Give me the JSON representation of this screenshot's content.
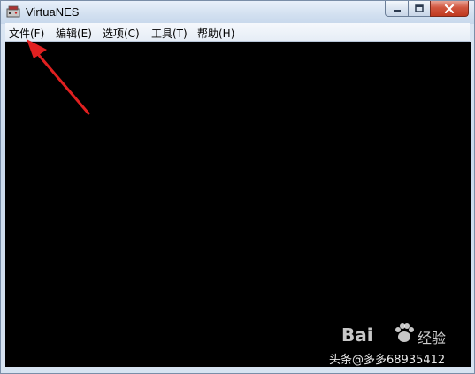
{
  "window": {
    "title": "VirtuaNES",
    "icon": "virtuanes-app-icon"
  },
  "title_buttons": {
    "minimize_icon": "minimize-icon",
    "maximize_icon": "maximize-icon",
    "close_icon": "close-icon"
  },
  "menubar": {
    "items": [
      {
        "label": "文件(F)"
      },
      {
        "label": "编辑(E)"
      },
      {
        "label": "选项(C)"
      },
      {
        "label": "工具(T)"
      },
      {
        "label": "帮助(H)"
      }
    ]
  },
  "annotation": {
    "arrow_color": "#e02020",
    "points_to": "文件(F)"
  },
  "watermark": {
    "logo": "Bai",
    "logo_suffix": "经验",
    "user": "头条@多多68935412"
  },
  "colors": {
    "client_background": "#000000",
    "close_button": "#c0391f"
  }
}
